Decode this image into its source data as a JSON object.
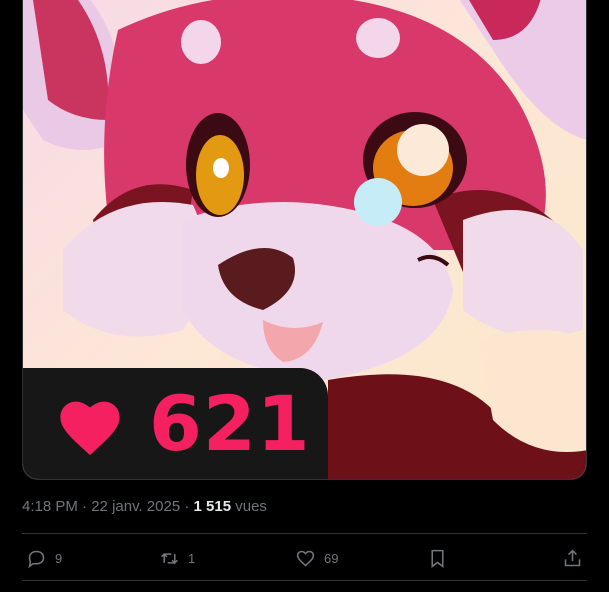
{
  "media": {
    "like_count": "621"
  },
  "meta": {
    "time": "4:18 PM",
    "dot": "·",
    "date": "22 janv. 2025",
    "views_count": "1 515",
    "views_label": "vues"
  },
  "actions": {
    "reply_count": "9",
    "retweet_count": "1",
    "like_count": "69"
  },
  "colors": {
    "background": "#000000",
    "accent_pink": "#f5205f",
    "muted_text": "#71767b"
  }
}
